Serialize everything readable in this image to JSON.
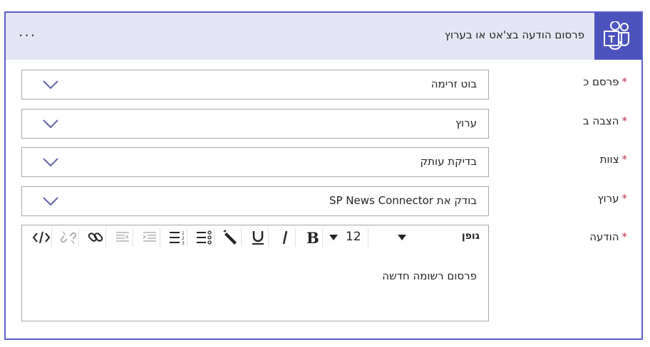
{
  "header": {
    "title": "פרסום הודעה בצ'אט או בערוץ",
    "more_label": "···",
    "app_icon": "teams-icon",
    "accent_color": "#4b53bc"
  },
  "form": {
    "fields": [
      {
        "label": "פרסם כ",
        "value": "בוט זרימה"
      },
      {
        "label": "הצבה ב",
        "value": "ערוץ"
      },
      {
        "label": "צוות",
        "value": "בדיקת עותק"
      },
      {
        "label": "ערוץ",
        "value": "בודק את SP News Connector"
      }
    ],
    "message_label": "הודעה",
    "required_mark": "*"
  },
  "editor": {
    "font_label": "גופן",
    "font_size": "12",
    "content": "פרסום רשומה חדשה",
    "toolbar_icons": [
      "code-icon",
      "unlink-icon",
      "link-icon",
      "align-left-icon",
      "align-right-icon",
      "numbered-list-icon",
      "bullet-list-icon",
      "highlight-icon",
      "underline-icon",
      "italic-icon",
      "bold-icon"
    ]
  }
}
